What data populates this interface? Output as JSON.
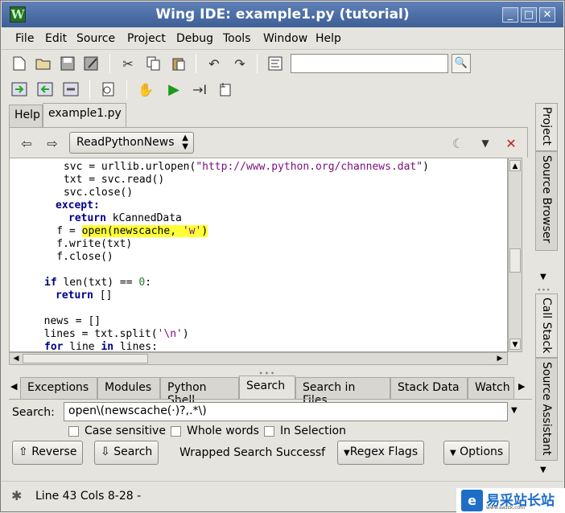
{
  "window": {
    "title": "Wing IDE: example1.py (tutorial)",
    "app_icon_glyph": "W",
    "controls": {
      "minimize": "_",
      "maximize": "□",
      "close": "✕"
    }
  },
  "menubar": {
    "items": [
      {
        "label": "File"
      },
      {
        "label": "Edit"
      },
      {
        "label": "Source"
      },
      {
        "label": "Project"
      },
      {
        "label": "Debug"
      },
      {
        "label": "Tools"
      },
      {
        "label": "Window"
      },
      {
        "label": "Help"
      }
    ]
  },
  "toolbar1": {
    "icons": [
      "new-file-icon",
      "open-folder-icon",
      "save-icon",
      "save-all-icon",
      "cut-icon",
      "copy-icon",
      "paste-icon",
      "undo-icon",
      "redo-icon",
      "goto-definition-icon"
    ],
    "search_value": ""
  },
  "toolbar2": {
    "icons": [
      "indent-right-icon",
      "indent-left-icon",
      "bookmark-icon",
      "debug-config-icon",
      "stop-hand-icon",
      "run-icon",
      "step-over-icon",
      "breakpoint-icon"
    ]
  },
  "editor": {
    "tabs": [
      {
        "label": "Help"
      },
      {
        "label": "example1.py"
      }
    ],
    "active_tab": "example1.py",
    "scope_dropdown": "ReadPythonNews",
    "code": {
      "l1a": "      svc = urllib.urlopen(",
      "l1b": "\"http://www.python.org/channews.dat\"",
      "l1c": ")",
      "l2": "      txt = svc.read()",
      "l3": "      svc.close()",
      "l4": "except",
      "l4b": ":",
      "l5a": "return",
      "l5b": " kCannedData",
      "l6a": "    f = ",
      "l6b": "open(newscache, ",
      "l6c": "'w'",
      "l6d": ")",
      "l7": "    f.write(txt)",
      "l8": "    f.close()",
      "l10a": "if",
      "l10b": " len(txt) == ",
      "l10c": "0",
      "l10d": ":",
      "l11a": "return",
      "l11b": " []",
      "l13": "  news = []",
      "l14a": "  lines = txt.split(",
      "l14b": "'\\n'",
      "l14c": ")",
      "l15a": "for",
      "l15b": " line ",
      "l15c": "in",
      "l15d": " lines:"
    }
  },
  "tool_tabs": [
    {
      "label": "Exceptions"
    },
    {
      "label": "Modules"
    },
    {
      "label": "Python Shell"
    },
    {
      "label": "Search"
    },
    {
      "label": "Search in Files"
    },
    {
      "label": "Stack Data"
    },
    {
      "label": "Watch"
    }
  ],
  "search": {
    "label": "Search:",
    "value": "open\\(newscache(·)?,.*\\)",
    "case_sensitive": "Case sensitive",
    "whole_words": "Whole words",
    "in_selection": "In Selection",
    "reverse_button": "Reverse",
    "search_button": "Search",
    "status": "Wrapped Search Successf",
    "regex_flags": "Regex Flags",
    "options": "Options"
  },
  "statusbar": {
    "text": "Line 43 Cols 8-28 -"
  },
  "dock_tabs": [
    "Project",
    "Source Browser",
    "Call Stack",
    "Source Assistant"
  ],
  "watermark": {
    "logo": "e",
    "text": "易采站长站",
    "sub": "www.easck.com"
  }
}
